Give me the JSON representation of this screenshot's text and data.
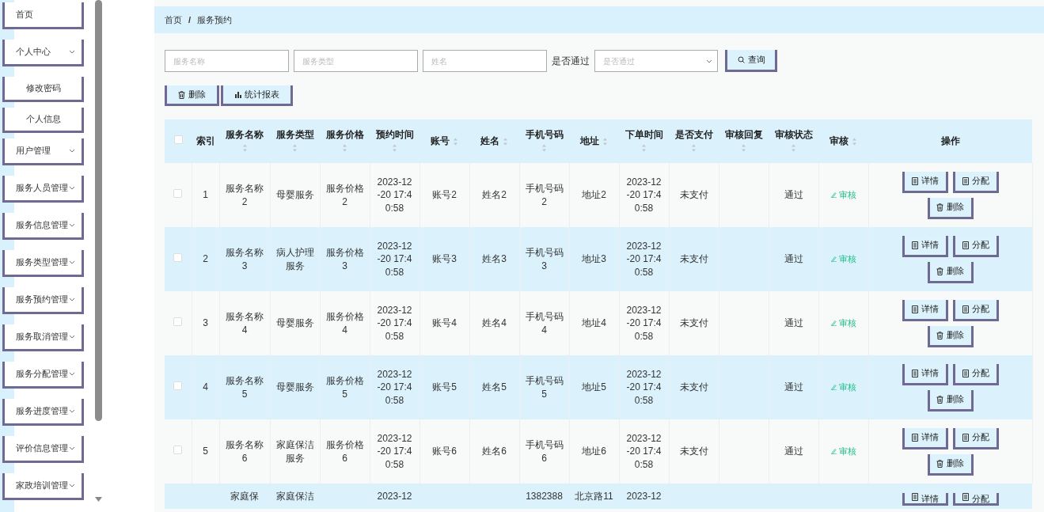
{
  "sidebar": {
    "items": [
      {
        "label": "首页",
        "kind": "link"
      },
      {
        "label": "个人中心",
        "kind": "group",
        "children": [
          {
            "label": "修改密码",
            "kind": "sub"
          },
          {
            "label": "个人信息",
            "kind": "sub"
          }
        ]
      },
      {
        "label": "用户管理",
        "kind": "group"
      },
      {
        "label": "服务人员管理",
        "kind": "group"
      },
      {
        "label": "服务信息管理",
        "kind": "group"
      },
      {
        "label": "服务类型管理",
        "kind": "group"
      },
      {
        "label": "服务预约管理",
        "kind": "group"
      },
      {
        "label": "服务取消管理",
        "kind": "group"
      },
      {
        "label": "服务分配管理",
        "kind": "group"
      },
      {
        "label": "服务进度管理",
        "kind": "group"
      },
      {
        "label": "评价信息管理",
        "kind": "group"
      },
      {
        "label": "家政培训管理",
        "kind": "group"
      }
    ]
  },
  "breadcrumb": {
    "separator": "/",
    "items": [
      "首页",
      "服务预约"
    ]
  },
  "search": {
    "fields": [
      {
        "placeholder": "服务名称"
      },
      {
        "placeholder": "服务类型"
      },
      {
        "placeholder": "姓名"
      }
    ],
    "select_label": "是否通过",
    "select": {
      "placeholder": "是否通过"
    },
    "button": "查询"
  },
  "toolbar": [
    {
      "kind": "delete",
      "label": "删除"
    },
    {
      "kind": "chart",
      "label": "统计报表"
    }
  ],
  "table": {
    "select_all": {
      "selected": false
    },
    "columns": [
      {
        "label": "索引",
        "sortable": false
      },
      {
        "label": "服务名称",
        "sortable": true
      },
      {
        "label": "服务类型",
        "sortable": true
      },
      {
        "label": "服务价格",
        "sortable": true
      },
      {
        "label": "预约时间",
        "sortable": true
      },
      {
        "label": "账号",
        "sortable": true
      },
      {
        "label": "姓名",
        "sortable": true
      },
      {
        "label": "手机号码",
        "sortable": true
      },
      {
        "label": "地址",
        "sortable": true
      },
      {
        "label": "下单时间",
        "sortable": true
      },
      {
        "label": "是否支付",
        "sortable": true
      },
      {
        "label": "审核回复",
        "sortable": true
      },
      {
        "label": "审核状态",
        "sortable": true
      },
      {
        "label": "审核",
        "sortable": true
      },
      {
        "label": "操作",
        "sortable": false
      }
    ],
    "rows": [
      {
        "selected": false,
        "cells": [
          "1",
          "服务名称2",
          "母婴服务",
          "服务价格2",
          "2023-12-20 17:40:58",
          "账号2",
          "姓名2",
          "手机号码2",
          "地址2",
          "2023-12-20 17:40:58",
          "未支付",
          null,
          "通过"
        ],
        "review_action": "审核",
        "actions": [
          {
            "kind": "detail",
            "label": "详情"
          },
          {
            "kind": "assign",
            "label": "分配"
          },
          {
            "kind": "delete",
            "label": "删除"
          }
        ]
      },
      {
        "selected": false,
        "cells": [
          "2",
          "服务名称3",
          "病人护理服务",
          "服务价格3",
          "2023-12-20 17:40:58",
          "账号3",
          "姓名3",
          "手机号码3",
          "地址3",
          "2023-12-20 17:40:58",
          "未支付",
          null,
          "通过"
        ],
        "review_action": "审核",
        "actions": [
          {
            "kind": "detail",
            "label": "详情"
          },
          {
            "kind": "assign",
            "label": "分配"
          },
          {
            "kind": "delete",
            "label": "删除"
          }
        ]
      },
      {
        "selected": false,
        "cells": [
          "3",
          "服务名称4",
          "母婴服务",
          "服务价格4",
          "2023-12-20 17:40:58",
          "账号4",
          "姓名4",
          "手机号码4",
          "地址4",
          "2023-12-20 17:40:58",
          "未支付",
          null,
          "通过"
        ],
        "review_action": "审核",
        "actions": [
          {
            "kind": "detail",
            "label": "详情"
          },
          {
            "kind": "assign",
            "label": "分配"
          },
          {
            "kind": "delete",
            "label": "删除"
          }
        ]
      },
      {
        "selected": false,
        "cells": [
          "4",
          "服务名称5",
          "母婴服务",
          "服务价格5",
          "2023-12-20 17:40:58",
          "账号5",
          "姓名5",
          "手机号码5",
          "地址5",
          "2023-12-20 17:40:58",
          "未支付",
          null,
          "通过"
        ],
        "review_action": "审核",
        "actions": [
          {
            "kind": "detail",
            "label": "详情"
          },
          {
            "kind": "assign",
            "label": "分配"
          },
          {
            "kind": "delete",
            "label": "删除"
          }
        ]
      },
      {
        "selected": false,
        "cells": [
          "5",
          "服务名称6",
          "家庭保洁服务",
          "服务价格6",
          "2023-12-20 17:40:58",
          "账号6",
          "姓名6",
          "手机号码6",
          "地址6",
          "2023-12-20 17:40:58",
          "未支付",
          null,
          "通过"
        ],
        "review_action": "审核",
        "actions": [
          {
            "kind": "detail",
            "label": "详情"
          },
          {
            "kind": "assign",
            "label": "分配"
          },
          {
            "kind": "delete",
            "label": "删除"
          }
        ]
      },
      {
        "cells": [
          "",
          "家庭保",
          "家庭保洁",
          "",
          "2023-12",
          "",
          "",
          "1382388",
          "北京路11",
          "2023-12",
          "",
          "",
          ""
        ],
        "actions": [
          {
            "kind": "detail",
            "label": "详情"
          },
          {
            "kind": "assign",
            "label": "分配"
          }
        ]
      }
    ]
  }
}
